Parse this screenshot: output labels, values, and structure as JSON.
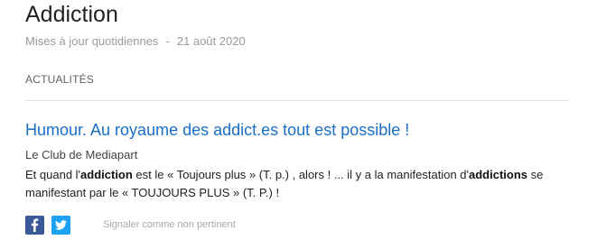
{
  "topic": {
    "title": "Addiction",
    "frequency": "Mises à jour quotidiennes",
    "separator": "-",
    "date": "21 août 2020"
  },
  "section": {
    "label": "ACTUALITÉS"
  },
  "article": {
    "headline": "Humour. Au royaume des addict.es tout est possible !",
    "source": "Le Club de Mediapart",
    "snippet": {
      "part1": "Et quand l'",
      "bold1": "addiction",
      "part2": " est le « Toujours plus » (T. p.) , alors ! ... il y a la manifestation d'",
      "bold2": "addictions",
      "part3": " se manifestant par le « TOUJOURS PLUS » (T. P.) !"
    }
  },
  "actions": {
    "facebook_icon": "facebook-icon",
    "twitter_icon": "twitter-icon",
    "report_label": "Signaler comme non pertinent"
  },
  "colors": {
    "headline": "#1a6fc4",
    "facebook": "#3b5998",
    "twitter": "#1da1f2"
  }
}
